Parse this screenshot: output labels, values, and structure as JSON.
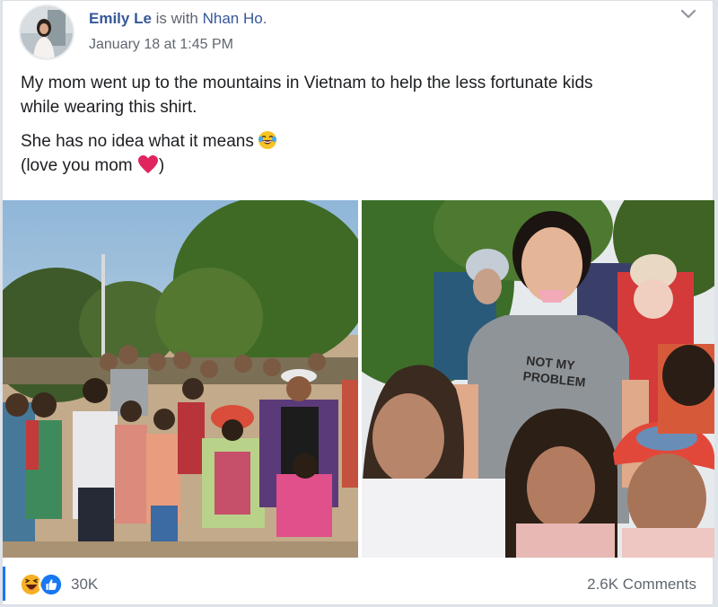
{
  "post": {
    "author": "Emily Le",
    "with_text": " is with ",
    "tagged": "Nhan Ho",
    "period": ".",
    "timestamp": "January 18 at 1:45 PM",
    "text": {
      "line1a": "My mom went up to the mountains in Vietnam to help the less fortunate kids",
      "line1b": "while wearing this shirt.",
      "line2": "She has no idea what it means",
      "line3_open": "(love you mom ",
      "line3_close": ")"
    },
    "shirt_text": {
      "line1": "NOT MY",
      "line2": "PROBLEM"
    }
  },
  "footer": {
    "reaction_count": "30K",
    "comments": "2.6K Comments"
  },
  "icons": {
    "options": "chevron-down-icon",
    "laugh_emoji": "laughing-crying-emoji",
    "heart_emoji": "red-heart-emoji",
    "haha_reaction": "haha-reaction-icon",
    "like_reaction": "like-reaction-icon"
  },
  "colors": {
    "link": "#365899",
    "meta": "#606770",
    "like_blue": "#1877f2",
    "haha_yellow": "#f7b125",
    "heart_red": "#e0245e"
  }
}
